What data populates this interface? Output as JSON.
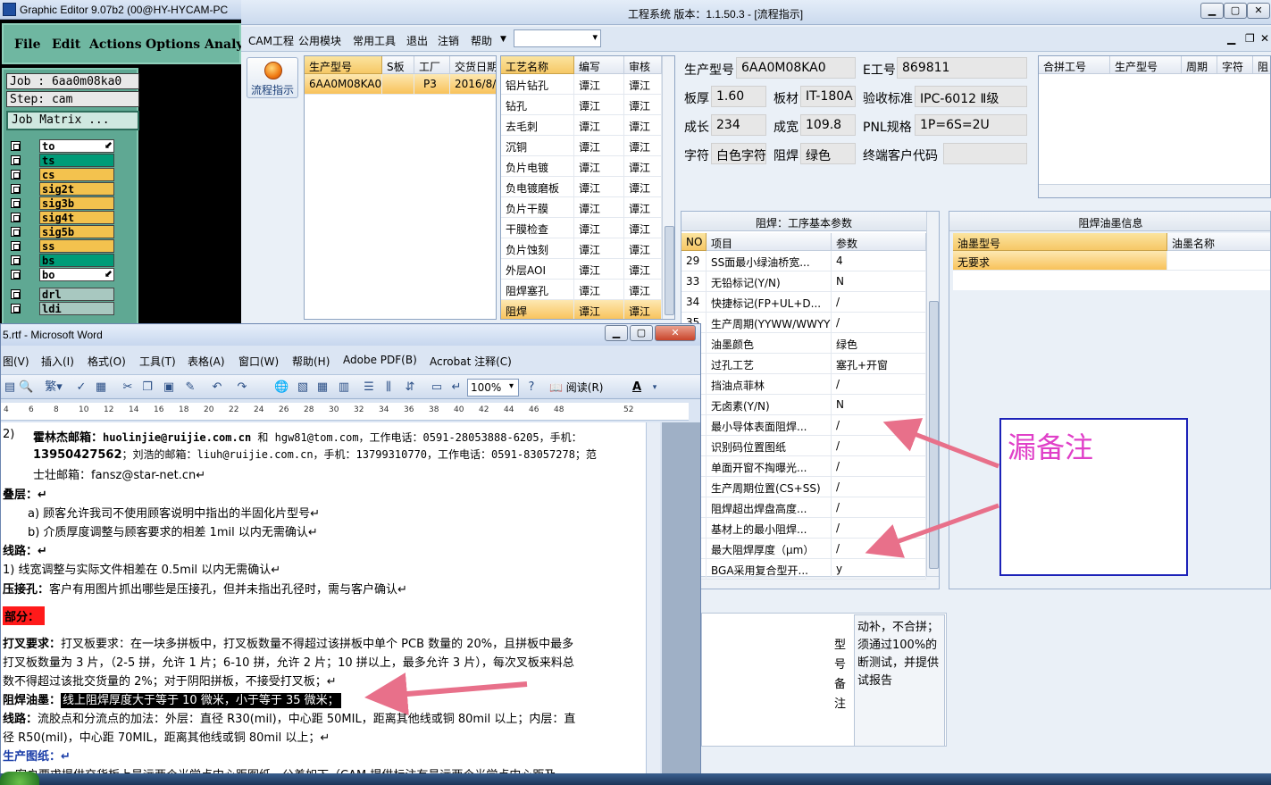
{
  "graphic_editor": {
    "title": "Graphic Editor 9.07b2 (00@HY-HYCAM-PC",
    "menu": [
      "File",
      "Edit",
      "Actions",
      "Options",
      "Analy"
    ],
    "job_field": "Job : 6aa0m08ka0",
    "step_field": "Step: cam",
    "job_matrix_button": "Job Matrix ...",
    "layers": [
      {
        "name": "to",
        "color": "#ffffff",
        "arrow": true
      },
      {
        "name": "ts",
        "color": "#009c78"
      },
      {
        "name": "cs",
        "color": "#f3c24e"
      },
      {
        "name": "sig2t",
        "color": "#f3c24e"
      },
      {
        "name": "sig3b",
        "color": "#f3c24e"
      },
      {
        "name": "sig4t",
        "color": "#f3c24e"
      },
      {
        "name": "sig5b",
        "color": "#f3c24e"
      },
      {
        "name": "ss",
        "color": "#f3c24e"
      },
      {
        "name": "bs",
        "color": "#009c78"
      },
      {
        "name": "bo",
        "color": "#ffffff",
        "arrow": true
      },
      {
        "name": "drl",
        "color": "#a8c8c0"
      },
      {
        "name": "ldi",
        "color": "#a8c8c0"
      }
    ]
  },
  "eng_system": {
    "title": "工程系统   版本：1.1.50.3 - [流程指示]",
    "menu": [
      "CAM工程",
      "公用模块",
      "常用工具",
      "退出",
      "注销",
      "帮助"
    ],
    "flow_button": "流程指示",
    "order_grid": {
      "headers": [
        "生产型号",
        "S板",
        "工厂",
        "交货日期"
      ],
      "rows": [
        [
          "6AA0M08KA0",
          "",
          "P3",
          "2016/8/"
        ]
      ]
    },
    "process_grid": {
      "headers": [
        "工艺名称",
        "编写",
        "审核"
      ],
      "rows": [
        [
          "铝片钻孔",
          "谭江",
          "谭江"
        ],
        [
          "钻孔",
          "谭江",
          "谭江"
        ],
        [
          "去毛刺",
          "谭江",
          "谭江"
        ],
        [
          "沉铜",
          "谭江",
          "谭江"
        ],
        [
          "负片电镀",
          "谭江",
          "谭江"
        ],
        [
          "负电镀磨板",
          "谭江",
          "谭江"
        ],
        [
          "负片干膜",
          "谭江",
          "谭江"
        ],
        [
          "干膜检查",
          "谭江",
          "谭江"
        ],
        [
          "负片蚀刻",
          "谭江",
          "谭江"
        ],
        [
          "外层AOI",
          "谭江",
          "谭江"
        ],
        [
          "阻焊塞孔",
          "谭江",
          "谭江"
        ],
        [
          "阻焊",
          "谭江",
          "谭江"
        ]
      ],
      "selected_row": 11
    },
    "info": {
      "prod_model_label": "生产型号",
      "prod_model": "6AA0M08KA0",
      "e_no_label": "E工号",
      "e_no": "869811",
      "thickness_label": "板厚",
      "thickness": "1.60",
      "material_label": "板材",
      "material": "IT-180A",
      "accept_label": "验收标准",
      "accept": "IPC-6012 Ⅱ级",
      "length_label": "成长",
      "length": "234",
      "width_label": "成宽",
      "width": "109.8",
      "pnl_label": "PNL规格",
      "pnl": "1P=6S=2U",
      "char_label": "字符",
      "char": "白色字符",
      "mask_label": "阻焊",
      "mask": "绿色",
      "end_cust_label": "终端客户代码",
      "end_cust": ""
    },
    "merge_grid": {
      "headers": [
        "合拼工号",
        "生产型号",
        "周期",
        "字符",
        "阻"
      ]
    },
    "mask_params": {
      "title": "阻焊：工序基本参数",
      "headers": [
        "NO",
        "项目",
        "参数"
      ],
      "rows": [
        [
          "29",
          "SS面最小绿油桥宽...",
          "4"
        ],
        [
          "33",
          "无铅标记(Y/N)",
          "N"
        ],
        [
          "34",
          "快捷标记(FP+UL+D...",
          "/"
        ],
        [
          "35",
          "生产周期(YYWW/WWYY)",
          "/"
        ],
        [
          "",
          "油墨颜色",
          "绿色"
        ],
        [
          "",
          "过孔工艺",
          "塞孔+开窗"
        ],
        [
          "",
          "挡油点菲林",
          "/"
        ],
        [
          "",
          "无卤素(Y/N)",
          "N"
        ],
        [
          "",
          "最小导体表面阻焊...",
          "/"
        ],
        [
          "",
          "识别码位置图纸",
          "/"
        ],
        [
          "",
          "单面开窗不掏曝光...",
          "/"
        ],
        [
          "",
          "生产周期位置(CS+SS)",
          "/"
        ],
        [
          "",
          "阻焊超出焊盘高度...",
          "/"
        ],
        [
          "",
          "基材上的最小阻焊...",
          "/"
        ],
        [
          "",
          "最大阻焊厚度（μm）",
          "/"
        ],
        [
          "",
          "BGA采用复合型开...",
          "y"
        ]
      ]
    },
    "ink_info": {
      "title": "阻焊油墨信息",
      "headers": [
        "油墨型号",
        "油墨名称"
      ],
      "rows": [
        [
          "无要求",
          ""
        ]
      ]
    },
    "remark": {
      "side_label": "型号备注",
      "text": [
        "动补，不合拼；",
        "须通过100%的",
        "断测试，并提供",
        "试报告"
      ]
    }
  },
  "word": {
    "title": "5.rtf - Microsoft Word",
    "menu": [
      "图(V)",
      "插入(I)",
      "格式(O)",
      "工具(T)",
      "表格(A)",
      "窗口(W)",
      "帮助(H)",
      "Adobe PDF(B)",
      "Acrobat 注释(C)"
    ],
    "zoom": "100%",
    "read_mode": "阅读(R)",
    "ruler": [
      "4",
      "6",
      "8",
      "10",
      "12",
      "14",
      "16",
      "18",
      "20",
      "22",
      "24",
      "26",
      "28",
      "30",
      "32",
      "34",
      "36",
      "38",
      "40",
      "42",
      "44",
      "46",
      "48",
      "52"
    ],
    "lines": {
      "l2_a": "2)   ",
      "l2_name": "霍林杰邮箱：",
      "l2_mail": "huolinjie@ruijie.com.cn",
      "l2_rest": " 和 hgw81@tom.com，工作电话：0591-28053888-6205，手机：",
      "l3_phone": "13950427562",
      "l3_rest": "；刘浩的邮箱：liuh@ruijie.com.cn，手机：13799310770，工作电话：0591-83057278；范",
      "l4": "士壮邮箱：fansz@star-net.cn↵",
      "stack_head": "叠层：↵",
      "stack_a": "a)    顾客允许我司不使用顾客说明中指出的半固化片型号↵",
      "stack_b": "b)    介质厚度调整与顾客要求的相差 1mil 以内无需确认↵",
      "line_head": "线路：↵",
      "line_1": "1) 线宽调整与实际文件相差在 0.5mil 以内无需确认↵",
      "press_head": "压接孔：",
      "press_text": "客户有用图片抓出哪些是压接孔，但并未指出孔径时，需与客户确认↵",
      "part_head": "部分：",
      "xboard_head": "打叉要求：",
      "xboard_1": "打叉板要求：在一块多拼板中，打叉板数量不得超过该拼板中单个 PCB 数量的 20%，且拼板中最多",
      "xboard_2": "打叉板数量为 3 片，（2-5 拼，允许 1 片；6-10 拼，允许 2 片；10 拼以上，最多允许 3 片），每次叉板来料总",
      "xboard_3": "数不得超过该批交货量的 2%；对于阴阳拼板，不接受打叉板；↵",
      "ink_head": "阻焊油墨：",
      "ink_text": "线上阻焊厚度大于等于 10 微米，小于等于 35 微米；",
      "route_head": "线路：",
      "route_1": "流胶点和分流点的加法：外层：直径 R30(mil)，中心距 50MIL，距离其他线或铜 80mil 以上；内层：直",
      "route_2": "径 R50(mil)，中心距 70MIL，距离其他线或铜 80mil 以上；↵",
      "draw_head": "生产图纸：↵",
      "draw_1": "客户要求提供交货板上最远两个光学点中心距图纸，公差如下（CAM 提供标注有最远两个光学点中心距及"
    }
  },
  "annotation": {
    "text": "漏备注",
    "text_color": "#e040c8",
    "border_color": "#1c22b8",
    "arrow_color": "#e8708a"
  }
}
